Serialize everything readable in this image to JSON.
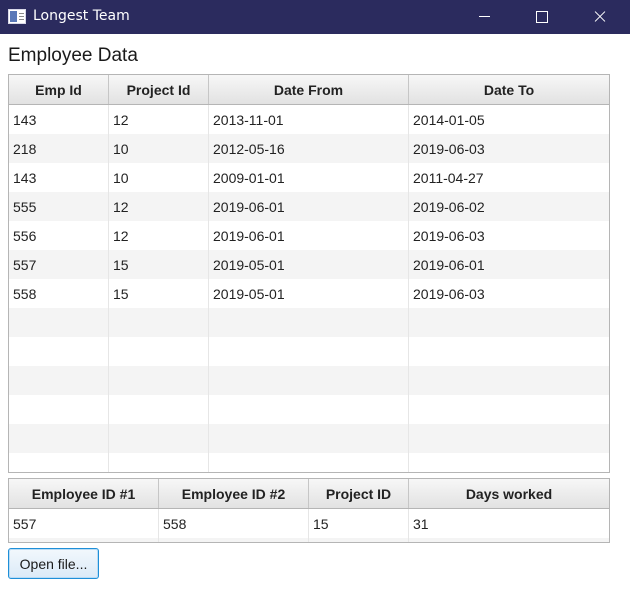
{
  "window": {
    "title": "Longest Team",
    "icon": "app-window-icon",
    "controls": [
      "minimize-icon",
      "maximize-icon",
      "close-icon"
    ]
  },
  "employee_section": {
    "heading": "Employee Data",
    "columns": [
      "Emp Id",
      "Project Id",
      "Date From",
      "Date To"
    ],
    "rows": [
      [
        "143",
        "12",
        "2013-11-01",
        "2014-01-05"
      ],
      [
        "218",
        "10",
        "2012-05-16",
        "2019-06-03"
      ],
      [
        "143",
        "10",
        "2009-01-01",
        "2011-04-27"
      ],
      [
        "555",
        "12",
        "2019-06-01",
        "2019-06-02"
      ],
      [
        "556",
        "12",
        "2019-06-01",
        "2019-06-03"
      ],
      [
        "557",
        "15",
        "2019-05-01",
        "2019-06-01"
      ],
      [
        "558",
        "15",
        "2019-05-01",
        "2019-06-03"
      ]
    ]
  },
  "result_section": {
    "columns": [
      "Employee ID #1",
      "Employee ID #2",
      "Project ID",
      "Days worked"
    ],
    "rows": [
      [
        "557",
        "558",
        "15",
        "31"
      ]
    ]
  },
  "actions": {
    "open_file_label": "Open file..."
  },
  "colors": {
    "titlebar": "#2b2b5e",
    "button_border": "#1e8fd8"
  }
}
